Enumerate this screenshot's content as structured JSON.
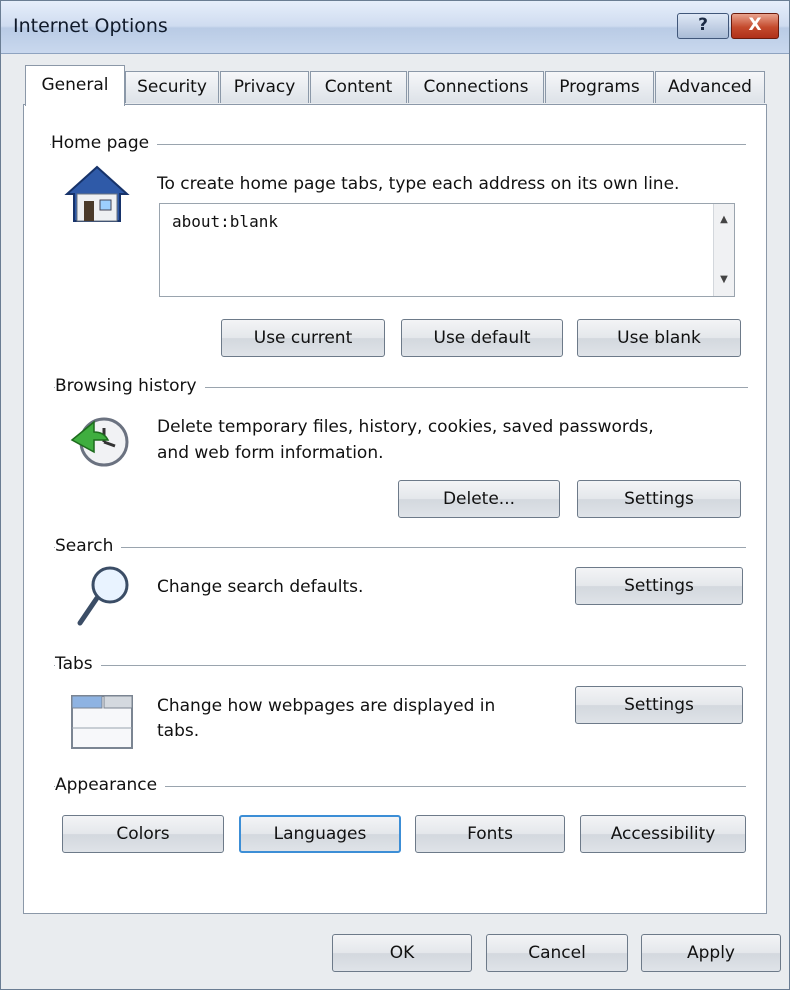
{
  "window": {
    "title": "Internet Options",
    "help_label": "?",
    "close_label": "X"
  },
  "tabs": [
    {
      "label": "General"
    },
    {
      "label": "Security"
    },
    {
      "label": "Privacy"
    },
    {
      "label": "Content"
    },
    {
      "label": "Connections"
    },
    {
      "label": "Programs"
    },
    {
      "label": "Advanced"
    }
  ],
  "home_page": {
    "group_label": "Home page",
    "description": "To create home page tabs, type each address on its own line.",
    "addresses_value": "about:blank",
    "buttons": {
      "use_current": "Use current",
      "use_default": "Use default",
      "use_blank": "Use blank"
    }
  },
  "browsing_history": {
    "group_label": "Browsing history",
    "description_line1": "Delete temporary files, history, cookies, saved passwords,",
    "description_line2": "and web form information.",
    "buttons": {
      "delete": "Delete...",
      "settings": "Settings"
    }
  },
  "search": {
    "group_label": "Search",
    "description": "Change search defaults.",
    "settings": "Settings"
  },
  "tabs_group": {
    "group_label": "Tabs",
    "description_line1": "Change how webpages are displayed in",
    "description_line2": "tabs.",
    "settings": "Settings"
  },
  "appearance": {
    "group_label": "Appearance",
    "buttons": {
      "colors": "Colors",
      "languages": "Languages",
      "fonts": "Fonts",
      "accessibility": "Accessibility"
    }
  },
  "dialog_buttons": {
    "ok": "OK",
    "cancel": "Cancel",
    "apply": "Apply"
  },
  "icons": {
    "home": "house-icon",
    "history": "clock-refresh-icon",
    "search": "magnifier-icon",
    "tabs": "tabs-window-icon",
    "scroll_up": "scroll-up-arrow-icon",
    "scroll_down": "scroll-down-arrow-icon"
  }
}
